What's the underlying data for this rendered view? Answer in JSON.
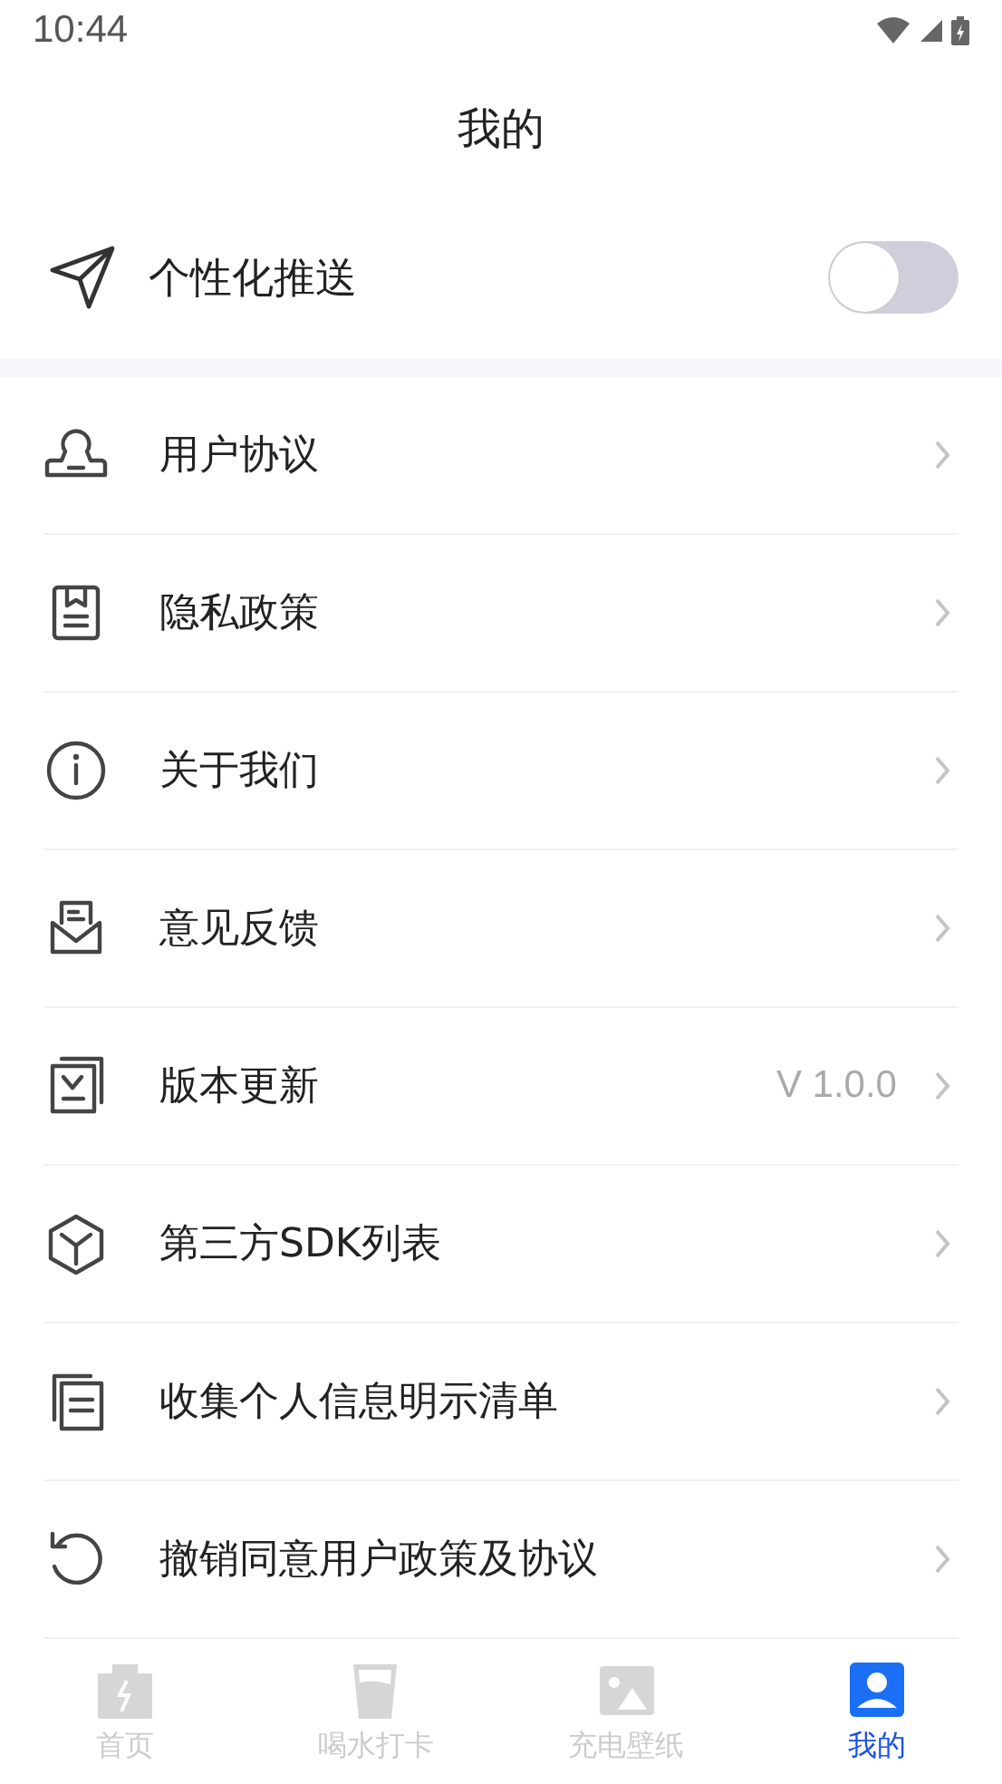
{
  "status_bar": {
    "time": "10:44"
  },
  "header": {
    "title": "我的"
  },
  "push_setting": {
    "label": "个性化推送",
    "on": false
  },
  "menu": [
    {
      "label": "用户协议"
    },
    {
      "label": "隐私政策"
    },
    {
      "label": "关于我们"
    },
    {
      "label": "意见反馈"
    },
    {
      "label": "版本更新",
      "value": "V 1.0.0"
    },
    {
      "label": "第三方SDK列表"
    },
    {
      "label": "收集个人信息明示清单"
    },
    {
      "label": "撤销同意用户政策及协议"
    }
  ],
  "tabs": [
    {
      "label": "首页",
      "selected": false
    },
    {
      "label": "喝水打卡",
      "selected": false
    },
    {
      "label": "充电壁纸",
      "selected": false
    },
    {
      "label": "我的",
      "selected": true
    }
  ]
}
